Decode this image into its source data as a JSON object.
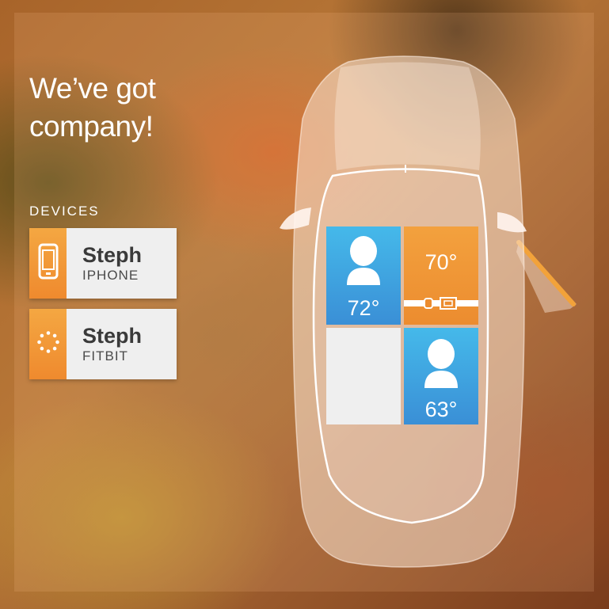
{
  "headline": {
    "line1": "We’ve got",
    "line2": "company!"
  },
  "devices": {
    "label": "DEVICES",
    "items": [
      {
        "name": "Steph",
        "type": "IPHONE",
        "icon": "phone-icon"
      },
      {
        "name": "Steph",
        "type": "FITBIT",
        "icon": "fitbit-icon"
      }
    ]
  },
  "seats": {
    "front_left": {
      "occupied": true,
      "temp": "72°",
      "icon": "person-icon"
    },
    "front_right": {
      "occupied": false,
      "temp": "70°",
      "icon": "seatbelt-icon"
    },
    "rear_left": {
      "occupied": false
    },
    "rear_right": {
      "occupied": true,
      "temp": "63°",
      "icon": "person-icon"
    }
  },
  "colors": {
    "accent_orange": "#ef8a2e",
    "seat_blue": "#45b9ea",
    "card_bg": "#efefef"
  }
}
